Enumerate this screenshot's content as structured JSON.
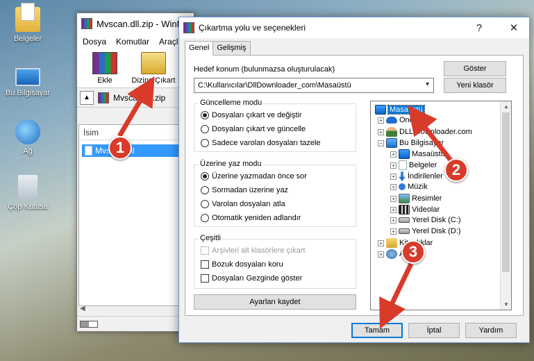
{
  "desktop": {
    "icons": [
      {
        "label": "Belgeler",
        "icon": "documents-folder-icon"
      },
      {
        "label": "Bu Bilgisayar",
        "icon": "this-pc-icon"
      },
      {
        "label": "Ağ",
        "icon": "network-icon"
      },
      {
        "label": "Çöp Kutusu",
        "icon": "recycle-bin-icon"
      }
    ]
  },
  "winrar": {
    "title": "Mvscan.dll.zip - WinRAR",
    "menu": [
      "Dosya",
      "Komutlar",
      "Araçlar"
    ],
    "toolbar": {
      "add_label": "Ekle",
      "extract_label": "Dizine Çıkart"
    },
    "path": "Mvscan.dll.zip",
    "column_name": "İsim",
    "file": "Mvscan.dll"
  },
  "dialog": {
    "title": "Çıkartma yolu ve seçenekleri",
    "tabs": [
      "Genel",
      "Gelişmiş"
    ],
    "destination_label": "Hedef konum (bulunmazsa oluşturulacak)",
    "destination_value": "C:\\Kullanıcılar\\DllDownloader_com\\Masaüstü",
    "show_button": "Göster",
    "new_folder_button": "Yeni klasör",
    "update_mode": {
      "title": "Güncelleme modu",
      "options": [
        "Dosyaları çıkart ve değiştir",
        "Dosyaları çıkart ve güncelle",
        "Sadece varolan dosyaları tazele"
      ],
      "selected": 0
    },
    "overwrite_mode": {
      "title": "Üzerine yaz modu",
      "options": [
        "Üzerine yazmadan önce sor",
        "Sormadan üzerine yaz",
        "Varolan dosyaları atla",
        "Otomatik yeniden adlandır"
      ],
      "selected": 0
    },
    "misc": {
      "title": "Çeşitli",
      "options": [
        {
          "label": "Arşivleri alt klasörlere çıkart",
          "checked": false,
          "disabled": true
        },
        {
          "label": "Bozuk dosyaları koru",
          "checked": false,
          "disabled": false
        },
        {
          "label": "Dosyaları Gezginde göster",
          "checked": false,
          "disabled": false
        }
      ]
    },
    "save_settings_button": "Ayarları kaydet",
    "tree": [
      {
        "label": "Masaüstü",
        "icon": "desktop-icon",
        "selected": true,
        "expander": ""
      },
      {
        "label": "OneDrive",
        "icon": "onedrive-icon",
        "selected": false,
        "expander": "+"
      },
      {
        "label": "DLL Downloader.com",
        "icon": "user-icon",
        "selected": false,
        "expander": "+"
      },
      {
        "label": "Bu Bilgisayar",
        "icon": "this-pc-icon",
        "selected": false,
        "expander": "−"
      },
      {
        "label": "Masaüstü",
        "icon": "desktop-icon",
        "selected": false,
        "expander": "+"
      },
      {
        "label": "Belgeler",
        "icon": "documents-icon",
        "selected": false,
        "expander": "+"
      },
      {
        "label": "İndirilenler",
        "icon": "downloads-icon",
        "selected": false,
        "expander": "+"
      },
      {
        "label": "Müzik",
        "icon": "music-icon",
        "selected": false,
        "expander": "+"
      },
      {
        "label": "Resimler",
        "icon": "pictures-icon",
        "selected": false,
        "expander": "+"
      },
      {
        "label": "Videolar",
        "icon": "videos-icon",
        "selected": false,
        "expander": "+"
      },
      {
        "label": "Yerel Disk (C:)",
        "icon": "drive-icon",
        "selected": false,
        "expander": "+"
      },
      {
        "label": "Yerel Disk (D:)",
        "icon": "drive-icon",
        "selected": false,
        "expander": "+"
      },
      {
        "label": "Kitaplıklar",
        "icon": "libraries-icon",
        "selected": false,
        "expander": "+"
      },
      {
        "label": "Ağ",
        "icon": "network-icon",
        "selected": false,
        "expander": "+"
      }
    ],
    "ok_button": "Tamam",
    "cancel_button": "İptal",
    "help_button": "Yardım"
  },
  "annotations": [
    "1",
    "2",
    "3"
  ],
  "colors": {
    "annotation": "#d93b2a",
    "selection": "#0078d7"
  }
}
